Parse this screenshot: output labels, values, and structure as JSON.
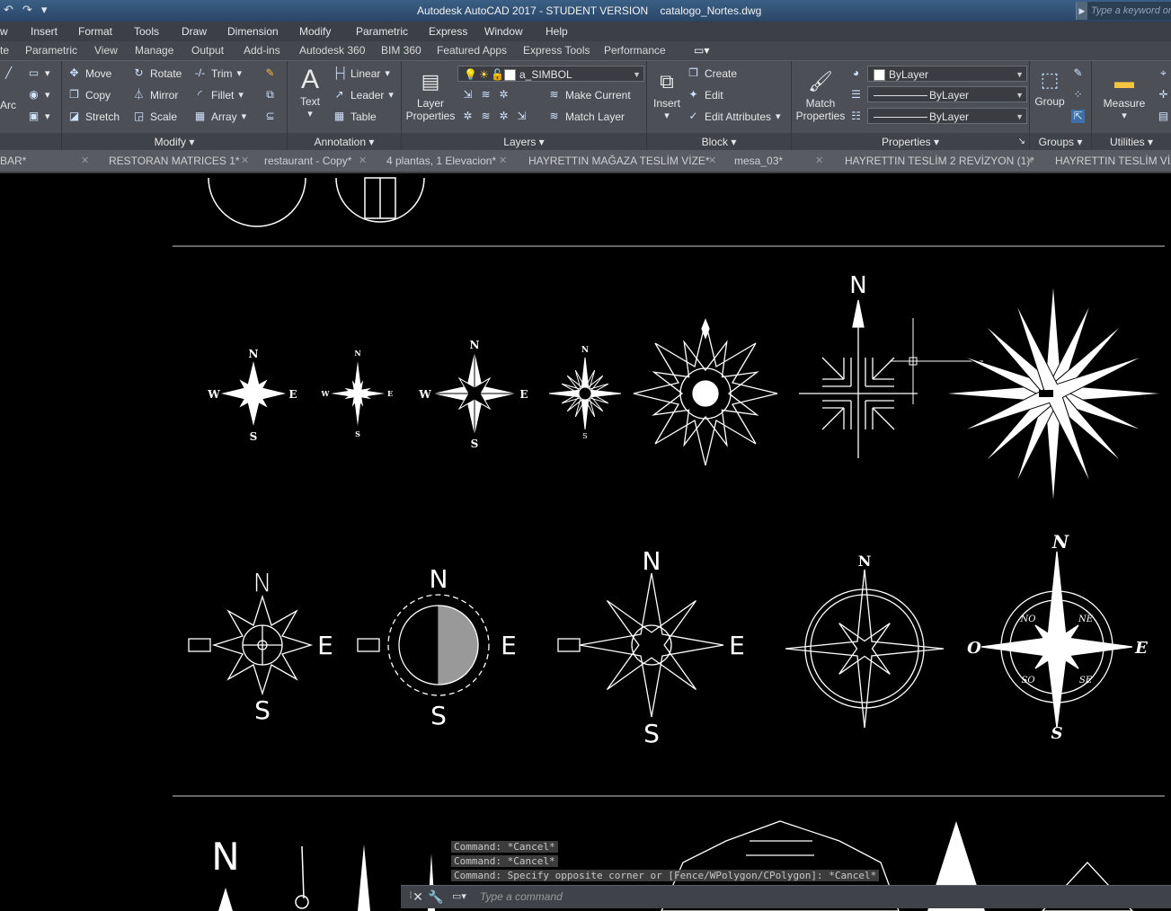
{
  "titlebar": {
    "qat_undo": "↶",
    "qat_more": "▾",
    "title": "Autodesk AutoCAD 2017 - STUDENT VERSION    catalogo_Nortes.dwg",
    "search_placeholder": "Type a keyword or"
  },
  "menubar": [
    "w",
    "Insert",
    "Format",
    "Tools",
    "Draw",
    "Dimension",
    "Modify",
    "Parametric",
    "Express",
    "Window",
    "Help"
  ],
  "ribbon_tabs": [
    "te",
    "Parametric",
    "View",
    "Manage",
    "Output",
    "Add-ins",
    "Autodesk 360",
    "BIM 360",
    "Featured Apps",
    "Express Tools",
    "Performance"
  ],
  "ribbon": {
    "draw_partial": "Arc",
    "modify": {
      "move": "Move",
      "rotate": "Rotate",
      "trim": "Trim",
      "copy": "Copy",
      "mirror": "Mirror",
      "fillet": "Fillet",
      "stretch": "Stretch",
      "scale": "Scale",
      "array": "Array",
      "footer": "Modify"
    },
    "annotation": {
      "text": "Text",
      "linear": "Linear",
      "leader": "Leader",
      "table": "Table",
      "footer": "Annotation"
    },
    "layers": {
      "layer_properties": "Layer Properties",
      "current_layer": "a_SIMBOL",
      "make_current": "Make Current",
      "match_layer": "Match Layer",
      "footer": "Layers"
    },
    "block": {
      "insert": "Insert",
      "create": "Create",
      "edit": "Edit",
      "edit_attributes": "Edit Attributes",
      "footer": "Block"
    },
    "properties": {
      "match_properties": "Match Properties",
      "color": "ByLayer",
      "linetype": "ByLayer",
      "lineweight": "ByLayer",
      "footer": "Properties"
    },
    "groups": {
      "group": "Group",
      "footer": "Groups"
    },
    "utilities": {
      "measure": "Measure",
      "footer": "Utilities"
    }
  },
  "file_tabs": [
    "BAR*",
    "RESTORAN MATRICES 1*",
    "restaurant - Copy*",
    "4 plantas, 1 Elevacion*",
    "HAYRETTIN MAĞAZA TESLİM VİZE*",
    "mesa_03*",
    "HAYRETTIN TESLİM 2 REVİZYON (1)*",
    "HAYRETTIN TESLİM VİZE"
  ],
  "drawing": {
    "row1": {
      "c1": {
        "n": "N",
        "s": "S",
        "e": "E",
        "w": "W"
      },
      "c2": {
        "n": "N",
        "s": "S",
        "e": "E",
        "w": "W"
      },
      "c3": {
        "n": "N",
        "s": "S",
        "e": "E",
        "w": "W"
      },
      "c4": {
        "n": "N",
        "s": "S"
      },
      "c6": {
        "n": "N"
      }
    },
    "row2": {
      "c1": {
        "n": "N",
        "s": "S",
        "e": "E"
      },
      "c2": {
        "n": "N",
        "s": "S",
        "e": "E"
      },
      "c3": {
        "n": "N",
        "s": "S",
        "e": "E"
      },
      "c4": {
        "n": "N"
      },
      "c5": {
        "n": "N",
        "s": "S",
        "e": "E",
        "o": "O",
        "ne": "NE",
        "no": "NO",
        "se": "SE",
        "so": "SO"
      }
    },
    "row3": {
      "n": "N"
    }
  },
  "command_history": [
    "Command: *Cancel*",
    "Command: *Cancel*",
    "Command: Specify opposite corner or [Fence/WPolygon/CPolygon]: *Cancel*"
  ],
  "command_placeholder": "Type a command",
  "colors": {
    "canvas": "#000000",
    "ribbon": "#4c4f56",
    "titlebar": "#2f4d6e"
  }
}
